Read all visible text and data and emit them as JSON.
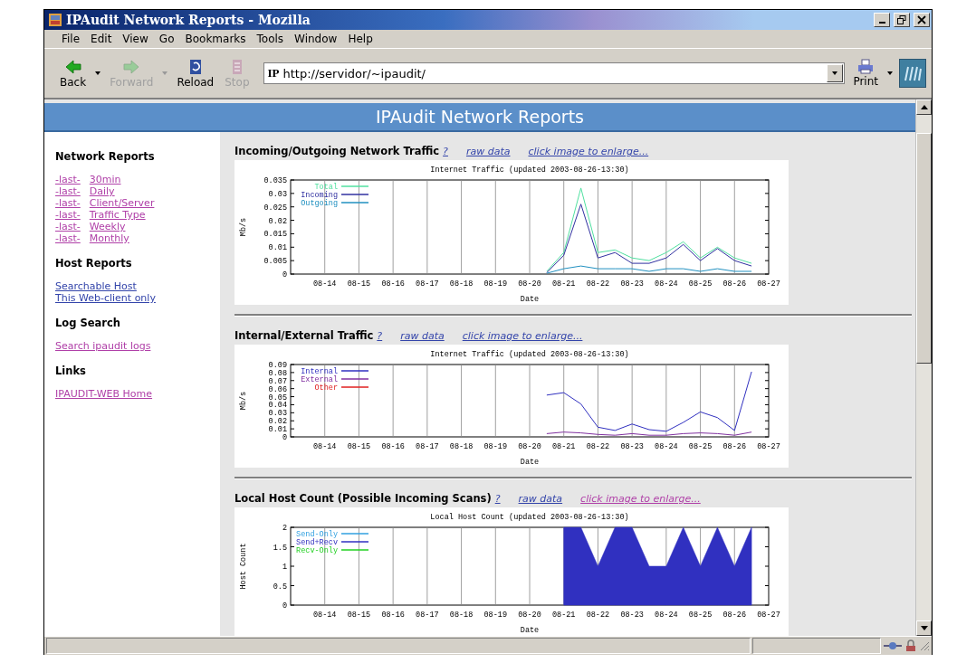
{
  "window": {
    "title": "IPAudit Network Reports - Mozilla"
  },
  "menu": [
    "File",
    "Edit",
    "View",
    "Go",
    "Bookmarks",
    "Tools",
    "Window",
    "Help"
  ],
  "toolbar": [
    {
      "label": "Back",
      "kind": "back",
      "disabled": false
    },
    {
      "label": "Forward",
      "kind": "forward",
      "disabled": true
    },
    {
      "label": "Reload",
      "kind": "reload",
      "disabled": false
    },
    {
      "label": "Stop",
      "kind": "stop",
      "disabled": true
    }
  ],
  "address": {
    "site_icon": "IP",
    "value": "http://servidor/~ipaudit/"
  },
  "print_button": {
    "label": "Print"
  },
  "banner": "IPAudit Network Reports",
  "sidebar": [
    {
      "heading": "Network Reports",
      "links": [
        {
          "prefix": "-last-",
          "label": "30min",
          "visited": true
        },
        {
          "prefix": "-last-",
          "label": "Daily",
          "visited": true
        },
        {
          "prefix": "-last-",
          "label": "Client/Server",
          "visited": true
        },
        {
          "prefix": "-last-",
          "label": "Traffic Type",
          "visited": true
        },
        {
          "prefix": "-last-",
          "label": "Weekly",
          "visited": true
        },
        {
          "prefix": "-last-",
          "label": "Monthly",
          "visited": true
        }
      ]
    },
    {
      "heading": "Host Reports",
      "links": [
        {
          "label": "Searchable Host",
          "visited": false
        },
        {
          "label": "This Web-client only",
          "visited": false
        }
      ]
    },
    {
      "heading": "Log Search",
      "links": [
        {
          "label": "Search ipaudit logs",
          "visited": true
        }
      ]
    },
    {
      "heading": "Links",
      "links": [
        {
          "label": "IPAUDIT-WEB Home",
          "visited": true
        }
      ]
    }
  ],
  "sections": [
    {
      "title": "Incoming/Outgoing Network Traffic",
      "links": [
        {
          "label": "?",
          "visited": false
        },
        {
          "label": "raw data",
          "visited": false
        },
        {
          "label": "click image to enlarge...",
          "visited": false
        }
      ],
      "chart_data": {
        "type": "line",
        "grid": true,
        "legend": "upper left",
        "title": "Internet Traffic (updated 2003-08-26-13:30)",
        "xlabel": "Date",
        "ylabel": "Mb/s",
        "ylim": [
          0,
          0.035
        ],
        "categories": [
          null,
          null,
          "08-14",
          null,
          "08-15",
          null,
          "08-16",
          null,
          "08-17",
          null,
          "08-18",
          null,
          "08-19",
          null,
          "08-20",
          null,
          "08-21",
          null,
          "08-22",
          null,
          "08-23",
          null,
          "08-24",
          null,
          "08-25",
          null,
          "08-26",
          null,
          "08-27"
        ],
        "yticks": [
          {
            "value": 0,
            "label": "0"
          },
          {
            "value": 0.005,
            "label": "0.005"
          },
          {
            "value": 0.01,
            "label": "0.01"
          },
          {
            "value": 0.015,
            "label": "0.015"
          },
          {
            "value": 0.02,
            "label": "0.02"
          },
          {
            "value": 0.025,
            "label": "0.025"
          },
          {
            "value": 0.03,
            "label": "0.03"
          },
          {
            "value": 0.035,
            "label": "0.035"
          }
        ],
        "series": [
          {
            "name": "Total",
            "color": "#50e0a0",
            "values": [
              null,
              null,
              null,
              null,
              null,
              null,
              null,
              null,
              null,
              null,
              null,
              null,
              null,
              null,
              null,
              0.001,
              0.008,
              0.032,
              0.008,
              0.009,
              0.006,
              0.005,
              0.008,
              0.012,
              0.006,
              0.01,
              0.006,
              0.004,
              null
            ]
          },
          {
            "name": "Incoming",
            "color": "#3030a0",
            "values": [
              null,
              null,
              null,
              null,
              null,
              null,
              null,
              null,
              null,
              null,
              null,
              null,
              null,
              null,
              null,
              0.0005,
              0.007,
              0.026,
              0.006,
              0.008,
              0.004,
              0.004,
              0.006,
              0.011,
              0.005,
              0.0095,
              0.005,
              0.003,
              null
            ]
          },
          {
            "name": "Outgoing",
            "color": "#2090c0",
            "values": [
              null,
              null,
              null,
              null,
              null,
              null,
              null,
              null,
              null,
              null,
              null,
              null,
              null,
              null,
              null,
              0.0003,
              0.002,
              0.003,
              0.002,
              0.002,
              0.002,
              0.001,
              0.002,
              0.002,
              0.001,
              0.002,
              0.001,
              0.001,
              null
            ]
          }
        ]
      }
    },
    {
      "title": "Internal/External Traffic",
      "links": [
        {
          "label": "?",
          "visited": false
        },
        {
          "label": "raw data",
          "visited": false
        },
        {
          "label": "click image to enlarge...",
          "visited": false
        }
      ],
      "chart_data": {
        "type": "line",
        "grid": true,
        "legend": "upper left",
        "title": "Internet Traffic (updated 2003-08-26-13:30)",
        "xlabel": "Date",
        "ylabel": "Mb/s",
        "ylim": [
          0,
          0.09
        ],
        "categories": [
          null,
          null,
          "08-14",
          null,
          "08-15",
          null,
          "08-16",
          null,
          "08-17",
          null,
          "08-18",
          null,
          "08-19",
          null,
          "08-20",
          null,
          "08-21",
          null,
          "08-22",
          null,
          "08-23",
          null,
          "08-24",
          null,
          "08-25",
          null,
          "08-26",
          null,
          "08-27"
        ],
        "yticks": [
          {
            "value": 0,
            "label": "0"
          },
          {
            "value": 0.01,
            "label": "0.01"
          },
          {
            "value": 0.02,
            "label": "0.02"
          },
          {
            "value": 0.03,
            "label": "0.03"
          },
          {
            "value": 0.04,
            "label": "0.04"
          },
          {
            "value": 0.05,
            "label": "0.05"
          },
          {
            "value": 0.06,
            "label": "0.06"
          },
          {
            "value": 0.07,
            "label": "0.07"
          },
          {
            "value": 0.08,
            "label": "0.08"
          },
          {
            "value": 0.09,
            "label": "0.09"
          }
        ],
        "series": [
          {
            "name": "Internal",
            "color": "#3030c0",
            "values": [
              null,
              null,
              null,
              null,
              null,
              null,
              null,
              null,
              null,
              null,
              null,
              null,
              null,
              null,
              null,
              0.052,
              0.055,
              0.041,
              0.012,
              0.008,
              0.016,
              0.009,
              0.007,
              0.018,
              0.031,
              0.024,
              0.008,
              0.081,
              null
            ]
          },
          {
            "name": "External",
            "color": "#8030a0",
            "values": [
              null,
              null,
              null,
              null,
              null,
              null,
              null,
              null,
              null,
              null,
              null,
              null,
              null,
              null,
              null,
              0.004,
              0.006,
              0.005,
              0.003,
              0.002,
              0.004,
              0.002,
              0.002,
              0.004,
              0.005,
              0.004,
              0.002,
              0.006,
              null
            ]
          },
          {
            "name": "Other",
            "color": "#e02020",
            "values": [
              null,
              null,
              null,
              null,
              null,
              null,
              null,
              null,
              null,
              null,
              null,
              null,
              null,
              null,
              null,
              null,
              null,
              null,
              null,
              null,
              null,
              null,
              null,
              null,
              null,
              null,
              null,
              null,
              null
            ]
          }
        ]
      }
    },
    {
      "title": "Local Host Count (Possible Incoming Scans)",
      "links": [
        {
          "label": "?",
          "visited": false
        },
        {
          "label": "raw data",
          "visited": false
        },
        {
          "label": "click image to enlarge...",
          "visited": true
        }
      ],
      "chart_data": {
        "type": "area",
        "stacked": true,
        "grid": true,
        "legend": "upper left",
        "title": "Local Host Count (updated 2003-08-26-13:30)",
        "xlabel": "Date",
        "ylabel": "Host Count",
        "ylim": [
          0,
          2
        ],
        "categories": [
          null,
          null,
          "08-14",
          null,
          "08-15",
          null,
          "08-16",
          null,
          "08-17",
          null,
          "08-18",
          null,
          "08-19",
          null,
          "08-20",
          null,
          "08-21",
          null,
          "08-22",
          null,
          "08-23",
          null,
          "08-24",
          null,
          "08-25",
          null,
          "08-26",
          null,
          "08-27"
        ],
        "yticks": [
          {
            "value": 0,
            "label": "0"
          },
          {
            "value": 0.5,
            "label": "0.5"
          },
          {
            "value": 1,
            "label": "1"
          },
          {
            "value": 1.5,
            "label": "1.5"
          },
          {
            "value": 2,
            "label": "2"
          }
        ],
        "series": [
          {
            "name": "Send-Only",
            "color": "#30a0e0",
            "values": [
              null,
              null,
              null,
              null,
              null,
              null,
              null,
              null,
              null,
              null,
              null,
              null,
              null,
              null,
              null,
              null,
              null,
              null,
              null,
              null,
              null,
              null,
              null,
              null,
              null,
              null,
              null,
              null,
              null
            ]
          },
          {
            "name": "Send+Recv",
            "color": "#3030c0",
            "values": [
              null,
              null,
              null,
              null,
              null,
              null,
              null,
              null,
              null,
              null,
              null,
              null,
              null,
              null,
              null,
              null,
              2,
              2,
              1,
              2,
              2,
              1,
              1,
              2,
              1,
              2,
              1,
              2,
              null
            ]
          },
          {
            "name": "Recv-Only",
            "color": "#20d020",
            "values": [
              null,
              null,
              null,
              null,
              null,
              null,
              null,
              null,
              null,
              null,
              null,
              null,
              null,
              null,
              null,
              null,
              null,
              null,
              null,
              null,
              null,
              null,
              null,
              null,
              null,
              null,
              null,
              null,
              null
            ]
          }
        ]
      }
    }
  ]
}
